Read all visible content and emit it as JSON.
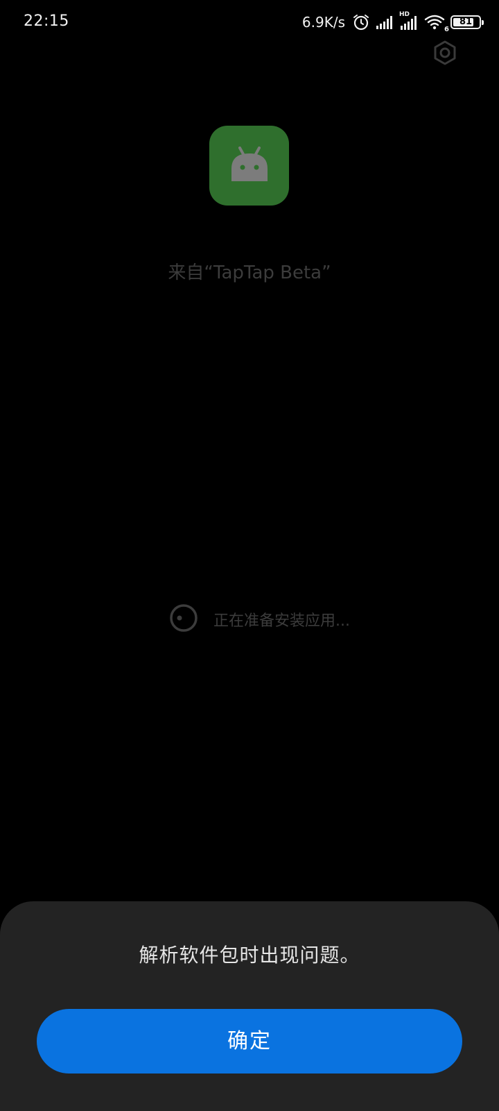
{
  "status_bar": {
    "time": "22:15",
    "net_speed": "6.9K/s",
    "network_type": "HD",
    "wifi_generation": "6",
    "battery_level": "81",
    "battery_fraction": 0.81,
    "icons": [
      "alarm-icon",
      "signal-icon",
      "signal-hd-icon",
      "wifi-icon",
      "battery-icon"
    ]
  },
  "header": {
    "settings_icon": "settings-icon"
  },
  "app": {
    "icon": "android-icon",
    "source_label": "来自“TapTap Beta”"
  },
  "progress": {
    "icon": "loading-spinner-icon",
    "text": "正在准备安装应用..."
  },
  "dialog": {
    "message": "解析软件包时出现问题。",
    "confirm_label": "确定"
  },
  "colors": {
    "background": "#000000",
    "dialog_background": "#232323",
    "accent": "#0a73e0",
    "app_icon_green": "#2f6f2d"
  }
}
